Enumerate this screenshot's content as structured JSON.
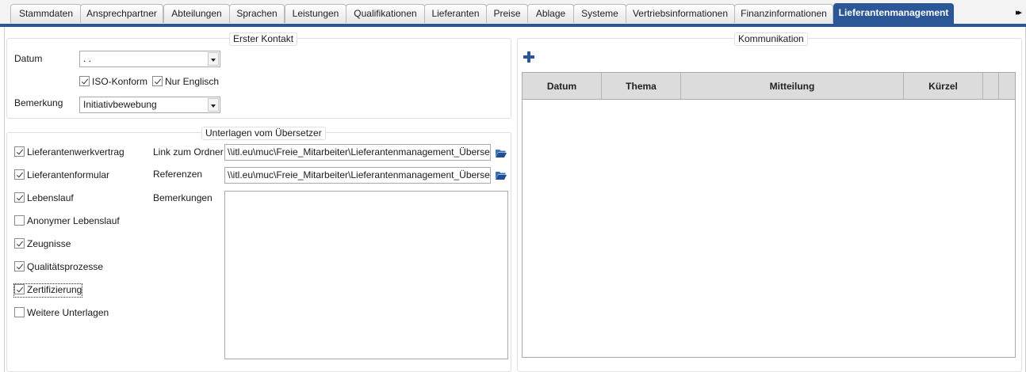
{
  "tabs": [
    {
      "label": "Stammdaten"
    },
    {
      "label": "Ansprechpartner"
    },
    {
      "label": "Abteilungen"
    },
    {
      "label": "Sprachen"
    },
    {
      "label": "Leistungen"
    },
    {
      "label": "Qualifikationen"
    },
    {
      "label": "Lieferanten"
    },
    {
      "label": "Preise"
    },
    {
      "label": "Ablage"
    },
    {
      "label": "Systeme"
    },
    {
      "label": "Vertriebsinformationen"
    },
    {
      "label": "Finanzinformationen"
    },
    {
      "label": "Lieferantenmanagement",
      "active": true
    }
  ],
  "tab_scroll_glyph": "▸▸",
  "accent_color": "#2b5797",
  "erster_kontakt": {
    "legend": "Erster Kontakt",
    "datum_label": "Datum",
    "datum_value": ". .",
    "iso_konform_label": "ISO-Konform",
    "iso_konform_checked": true,
    "nur_englisch_label": "Nur Englisch",
    "nur_englisch_checked": true,
    "bemerkung_label": "Bemerkung",
    "bemerkung_value": "Initiativbewebung"
  },
  "unterlagen": {
    "legend": "Unterlagen vom Übersetzer",
    "checkboxes": [
      {
        "label": "Lieferantenwerkvertrag",
        "checked": true
      },
      {
        "label": "Lieferantenformular",
        "checked": true
      },
      {
        "label": "Lebenslauf",
        "checked": true
      },
      {
        "label": "Anonymer Lebenslauf",
        "checked": false
      },
      {
        "label": "Zeugnisse",
        "checked": true
      },
      {
        "label": "Qualitätsprozesse",
        "checked": true
      },
      {
        "label": "Zertifizierung",
        "checked": true,
        "focused": true
      },
      {
        "label": "Weitere Unterlagen",
        "checked": false
      }
    ],
    "link_label": "Link zum Ordner",
    "link_value": "\\\\itl.eu\\muc\\Freie_Mitarbeiter\\Lieferantenmanagement_Übersetz",
    "referenzen_label": "Referenzen",
    "referenzen_value": "\\\\itl.eu\\muc\\Freie_Mitarbeiter\\Lieferantenmanagement_Übersetz",
    "bemerkungen_label": "Bemerkungen",
    "bemerkungen_value": ""
  },
  "kommunikation": {
    "legend": "Kommunikation",
    "add_icon": "plus-icon",
    "columns": [
      "Datum",
      "Thema",
      "Mitteilung",
      "Kürzel",
      "",
      ""
    ]
  }
}
